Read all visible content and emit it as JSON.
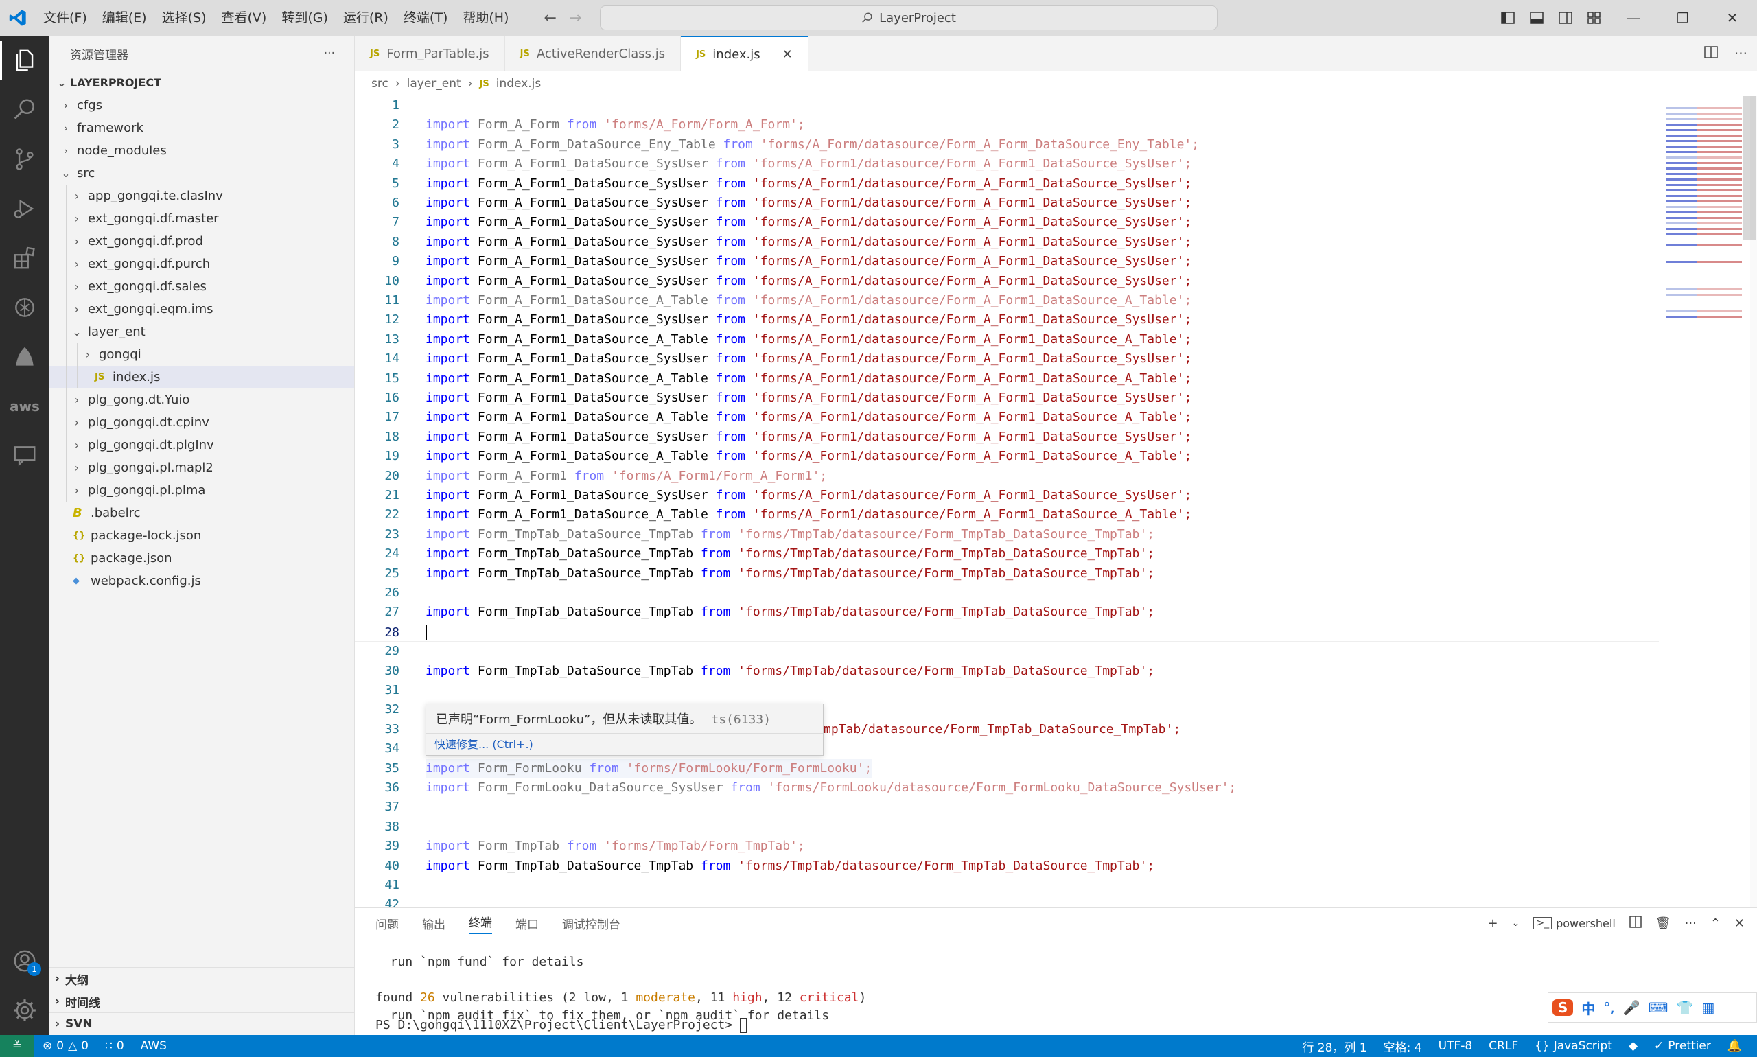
{
  "titlebar": {
    "menu": [
      "文件(F)",
      "编辑(E)",
      "选择(S)",
      "查看(V)",
      "转到(G)",
      "运行(R)",
      "终端(T)",
      "帮助(H)"
    ],
    "search": "LayerProject"
  },
  "sidebar": {
    "title": "资源管理器",
    "more": "···",
    "project": "LAYERPROJECT",
    "tree": [
      {
        "label": "cfgs",
        "depth": 0,
        "type": "folder",
        "open": false
      },
      {
        "label": "framework",
        "depth": 0,
        "type": "folder",
        "open": false
      },
      {
        "label": "node_modules",
        "depth": 0,
        "type": "folder",
        "open": false
      },
      {
        "label": "src",
        "depth": 0,
        "type": "folder",
        "open": true
      },
      {
        "label": "app_gongqi.te.clasInv",
        "depth": 1,
        "type": "folder",
        "open": false
      },
      {
        "label": "ext_gongqi.df.master",
        "depth": 1,
        "type": "folder",
        "open": false
      },
      {
        "label": "ext_gongqi.df.prod",
        "depth": 1,
        "type": "folder",
        "open": false
      },
      {
        "label": "ext_gongqi.df.purch",
        "depth": 1,
        "type": "folder",
        "open": false
      },
      {
        "label": "ext_gongqi.df.sales",
        "depth": 1,
        "type": "folder",
        "open": false
      },
      {
        "label": "ext_gongqi.eqm.ims",
        "depth": 1,
        "type": "folder",
        "open": false
      },
      {
        "label": "layer_ent",
        "depth": 1,
        "type": "folder",
        "open": true
      },
      {
        "label": "gongqi",
        "depth": 2,
        "type": "folder",
        "open": false
      },
      {
        "label": "index.js",
        "depth": 2,
        "type": "js",
        "selected": true
      },
      {
        "label": "plg_gong.dt.Yuio",
        "depth": 1,
        "type": "folder",
        "open": false
      },
      {
        "label": "plg_gongqi.dt.cpinv",
        "depth": 1,
        "type": "folder",
        "open": false
      },
      {
        "label": "plg_gongqi.dt.plgInv",
        "depth": 1,
        "type": "folder",
        "open": false
      },
      {
        "label": "plg_gongqi.pl.mapl2",
        "depth": 1,
        "type": "folder",
        "open": false
      },
      {
        "label": "plg_gongqi.pl.plma",
        "depth": 1,
        "type": "folder",
        "open": false
      },
      {
        "label": ".babelrc",
        "depth": 0,
        "type": "babel"
      },
      {
        "label": "package-lock.json",
        "depth": 0,
        "type": "json"
      },
      {
        "label": "package.json",
        "depth": 0,
        "type": "json"
      },
      {
        "label": "webpack.config.js",
        "depth": 0,
        "type": "webpack"
      }
    ],
    "sections": [
      "大纲",
      "时间线",
      "SVN"
    ]
  },
  "tabs": [
    {
      "label": "Form_ParTable.js",
      "active": false
    },
    {
      "label": "ActiveRenderClass.js",
      "active": false
    },
    {
      "label": "index.js",
      "active": true
    }
  ],
  "breadcrumb": [
    "src",
    "layer_ent",
    "index.js"
  ],
  "code": [
    {
      "n": 1
    },
    {
      "n": 2,
      "name": "Form_A_Form",
      "path": "'forms/A_Form/Form_A_Form';",
      "dim": true
    },
    {
      "n": 3,
      "name": "Form_A_Form_DataSource_Eny_Table",
      "path": "'forms/A_Form/datasource/Form_A_Form_DataSource_Eny_Table';",
      "dim": true
    },
    {
      "n": 4,
      "name": "Form_A_Form1_DataSource_SysUser",
      "path": "'forms/A_Form1/datasource/Form_A_Form1_DataSource_SysUser';",
      "dim": true
    },
    {
      "n": 5,
      "name": "Form_A_Form1_DataSource_SysUser",
      "path": "'forms/A_Form1/datasource/Form_A_Form1_DataSource_SysUser';"
    },
    {
      "n": 6,
      "name": "Form_A_Form1_DataSource_SysUser",
      "path": "'forms/A_Form1/datasource/Form_A_Form1_DataSource_SysUser';"
    },
    {
      "n": 7,
      "name": "Form_A_Form1_DataSource_SysUser",
      "path": "'forms/A_Form1/datasource/Form_A_Form1_DataSource_SysUser';"
    },
    {
      "n": 8,
      "name": "Form_A_Form1_DataSource_SysUser",
      "path": "'forms/A_Form1/datasource/Form_A_Form1_DataSource_SysUser';"
    },
    {
      "n": 9,
      "name": "Form_A_Form1_DataSource_SysUser",
      "path": "'forms/A_Form1/datasource/Form_A_Form1_DataSource_SysUser';"
    },
    {
      "n": 10,
      "name": "Form_A_Form1_DataSource_SysUser",
      "path": "'forms/A_Form1/datasource/Form_A_Form1_DataSource_SysUser';"
    },
    {
      "n": 11,
      "name": "Form_A_Form1_DataSource_A_Table",
      "path": "'forms/A_Form1/datasource/Form_A_Form1_DataSource_A_Table';",
      "dim": true
    },
    {
      "n": 12,
      "name": "Form_A_Form1_DataSource_SysUser",
      "path": "'forms/A_Form1/datasource/Form_A_Form1_DataSource_SysUser';"
    },
    {
      "n": 13,
      "name": "Form_A_Form1_DataSource_A_Table",
      "path": "'forms/A_Form1/datasource/Form_A_Form1_DataSource_A_Table';"
    },
    {
      "n": 14,
      "name": "Form_A_Form1_DataSource_SysUser",
      "path": "'forms/A_Form1/datasource/Form_A_Form1_DataSource_SysUser';"
    },
    {
      "n": 15,
      "name": "Form_A_Form1_DataSource_A_Table",
      "path": "'forms/A_Form1/datasource/Form_A_Form1_DataSource_A_Table';"
    },
    {
      "n": 16,
      "name": "Form_A_Form1_DataSource_SysUser",
      "path": "'forms/A_Form1/datasource/Form_A_Form1_DataSource_SysUser';"
    },
    {
      "n": 17,
      "name": "Form_A_Form1_DataSource_A_Table",
      "path": "'forms/A_Form1/datasource/Form_A_Form1_DataSource_A_Table';"
    },
    {
      "n": 18,
      "name": "Form_A_Form1_DataSource_SysUser",
      "path": "'forms/A_Form1/datasource/Form_A_Form1_DataSource_SysUser';"
    },
    {
      "n": 19,
      "name": "Form_A_Form1_DataSource_A_Table",
      "path": "'forms/A_Form1/datasource/Form_A_Form1_DataSource_A_Table';"
    },
    {
      "n": 20,
      "name": "Form_A_Form1",
      "path": "'forms/A_Form1/Form_A_Form1';",
      "dim": true
    },
    {
      "n": 21,
      "name": "Form_A_Form1_DataSource_SysUser",
      "path": "'forms/A_Form1/datasource/Form_A_Form1_DataSource_SysUser';"
    },
    {
      "n": 22,
      "name": "Form_A_Form1_DataSource_A_Table",
      "path": "'forms/A_Form1/datasource/Form_A_Form1_DataSource_A_Table';"
    },
    {
      "n": 23,
      "name": "Form_TmpTab_DataSource_TmpTab",
      "path": "'forms/TmpTab/datasource/Form_TmpTab_DataSource_TmpTab';",
      "dim": true
    },
    {
      "n": 24,
      "name": "Form_TmpTab_DataSource_TmpTab",
      "path": "'forms/TmpTab/datasource/Form_TmpTab_DataSource_TmpTab';"
    },
    {
      "n": 25,
      "name": "Form_TmpTab_DataSource_TmpTab",
      "path": "'forms/TmpTab/datasource/Form_TmpTab_DataSource_TmpTab';"
    },
    {
      "n": 26
    },
    {
      "n": 27,
      "name": "Form_TmpTab_DataSource_TmpTab",
      "path": "'forms/TmpTab/datasource/Form_TmpTab_DataSource_TmpTab';"
    },
    {
      "n": 28,
      "current": true
    },
    {
      "n": 29
    },
    {
      "n": 30,
      "name": "Form_TmpTab_DataSource_TmpTab",
      "path": "'forms/TmpTab/datasource/Form_TmpTab_DataSource_TmpTab';"
    },
    {
      "n": 31
    },
    {
      "n": 32
    },
    {
      "n": 33,
      "tail": "mpTab/datasource/Form_TmpTab_DataSource_TmpTab';"
    },
    {
      "n": 34
    },
    {
      "n": 35,
      "name": "Form_FormLooku",
      "path": "'forms/FormLooku/Form_FormLooku';",
      "dim": true,
      "highlight": true
    },
    {
      "n": 36,
      "name": "Form_FormLooku_DataSource_SysUser",
      "path": "'forms/FormLooku/datasource/Form_FormLooku_DataSource_SysUser';",
      "dim": true
    },
    {
      "n": 37
    },
    {
      "n": 38
    },
    {
      "n": 39,
      "name": "Form_TmpTab",
      "path": "'forms/TmpTab/Form_TmpTab';",
      "dim": true
    },
    {
      "n": 40,
      "name": "Form_TmpTab_DataSource_TmpTab",
      "path": "'forms/TmpTab/datasource/Form_TmpTab_DataSource_TmpTab';"
    },
    {
      "n": 41
    },
    {
      "n": 42
    }
  ],
  "keywords": {
    "import": "import",
    "from": "from"
  },
  "hover": {
    "message": "已声明“Form_FormLooku”，但从未读取其值。",
    "code": "ts(6133)",
    "action": "快速修复... (Ctrl+.)"
  },
  "panel": {
    "tabs": [
      "问题",
      "输出",
      "终端",
      "端口",
      "调试控制台"
    ],
    "active_tab": "终端",
    "shell": "powershell",
    "lines": {
      "l1": "  run `npm fund` for details",
      "found": "found ",
      "count": "26",
      "vuln": " vulnerabilities (2 low, 1 ",
      "moderate": "moderate",
      "mid": ", 11 ",
      "high": "high",
      "mid2": ", 12 ",
      "critical": "critical",
      "end": ")",
      "l3": "  run `npm audit fix` to fix them, or `npm audit` for details",
      "prompt": "PS D:\\gongqi\\1110XZ\\Project\\Client\\LayerProject> "
    }
  },
  "statusbar": {
    "errors": "0",
    "warnings": "0",
    "ports": "0",
    "aws": "AWS",
    "position": "行 28，列 1",
    "spaces": "空格: 4",
    "encoding": "UTF-8",
    "eol": "CRLF",
    "language": "JavaScript",
    "prettier": "Prettier"
  },
  "ime": {
    "label": "中"
  },
  "colors": {
    "accent": "#007acc",
    "keyword": "#0000ff",
    "string": "#a31515",
    "line_number": "#237893"
  }
}
